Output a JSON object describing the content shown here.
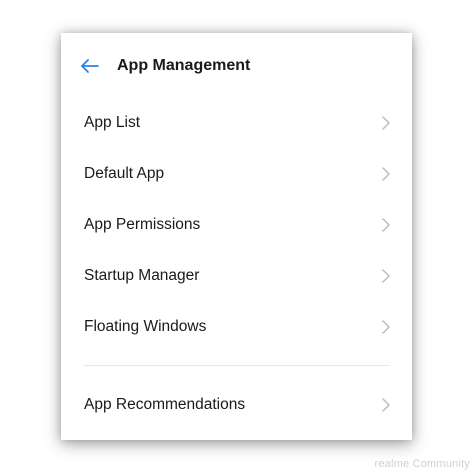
{
  "header": {
    "title": "App Management"
  },
  "menu": {
    "items": [
      {
        "label": "App List"
      },
      {
        "label": "Default App"
      },
      {
        "label": "App Permissions"
      },
      {
        "label": "Startup Manager"
      },
      {
        "label": "Floating Windows"
      }
    ],
    "recommendation": {
      "label": "App Recommendations"
    }
  },
  "icons": {
    "back": "arrow-left-icon",
    "chevron": "chevron-right-icon"
  },
  "colors": {
    "accent": "#2f80ed",
    "text": "#1a1a1a",
    "chevron": "#b8b8b8",
    "divider": "#e6e6e6"
  },
  "watermark": {
    "text": "realme Community"
  }
}
